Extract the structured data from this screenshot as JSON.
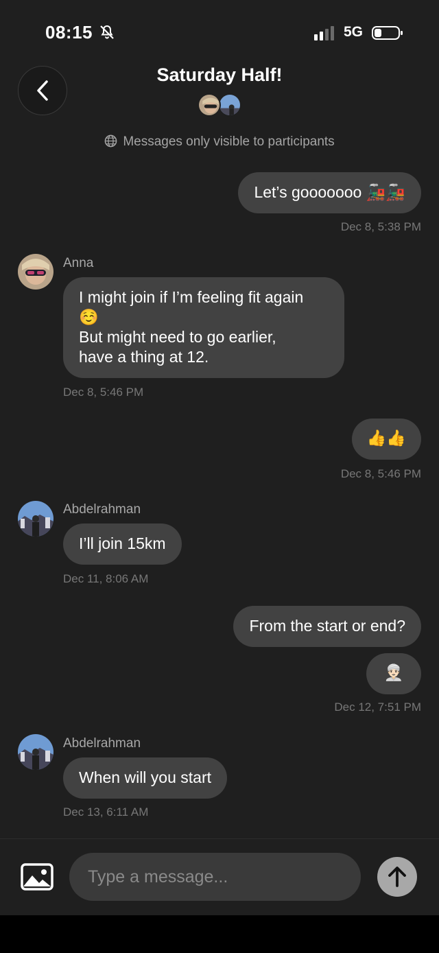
{
  "status_bar": {
    "time": "08:15",
    "network": "5G"
  },
  "header": {
    "title": "Saturday Half!",
    "privacy_note": "Messages only visible to participants"
  },
  "messages": [
    {
      "direction": "outgoing",
      "text": "Let’s gooooooo 🚂🚂",
      "timestamp": "Dec 8, 5:38 PM"
    },
    {
      "direction": "incoming",
      "sender": "Anna",
      "lines": [
        "I might join if I’m feeling fit again",
        "☺️",
        "But might need to go earlier,",
        "have a thing at 12."
      ],
      "timestamp": "Dec 8, 5:46 PM"
    },
    {
      "direction": "outgoing",
      "text": "👍👍",
      "timestamp": "Dec 8, 5:46 PM"
    },
    {
      "direction": "incoming",
      "sender": "Abdelrahman",
      "text": "I’ll join 15km",
      "timestamp": "Dec 11, 8:06 AM"
    },
    {
      "direction": "outgoing",
      "texts": [
        "From the start or end?",
        "👳🏻‍♂️"
      ],
      "timestamp": "Dec 12, 7:51 PM"
    },
    {
      "direction": "incoming",
      "sender": "Abdelrahman",
      "text": "When will you start",
      "timestamp": "Dec 13, 6:11 AM"
    }
  ],
  "composer": {
    "placeholder": "Type a message..."
  },
  "icons": {
    "back": "chevron-left-icon",
    "globe": "globe-icon",
    "image": "image-icon",
    "send": "arrow-up-icon",
    "bell": "bell-slash-icon"
  }
}
